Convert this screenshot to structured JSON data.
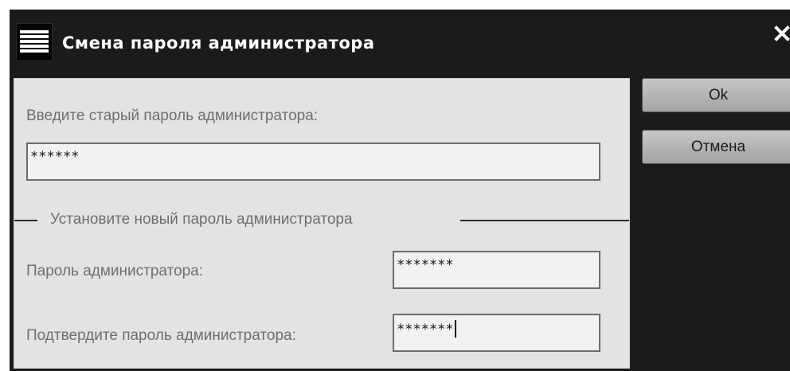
{
  "dialog": {
    "title": "Смена пароля администратора",
    "icons": {
      "app": "list-icon",
      "close": "close-icon"
    }
  },
  "old_password": {
    "label": "Введите старый пароль администратора:",
    "value": "******"
  },
  "new_password_group": {
    "legend": "Установите новый пароль администратора",
    "password_label": "Пароль администратора:",
    "password_value": "*******",
    "confirm_label": "Подтвердите пароль администратора:",
    "confirm_value": "*******"
  },
  "buttons": {
    "ok": "Ok",
    "cancel": "Отмена"
  },
  "colors": {
    "dialog_bg": "#1b1b1b",
    "panel_bg": "#e3e3e3",
    "button_bg": "#b4b4b4"
  }
}
